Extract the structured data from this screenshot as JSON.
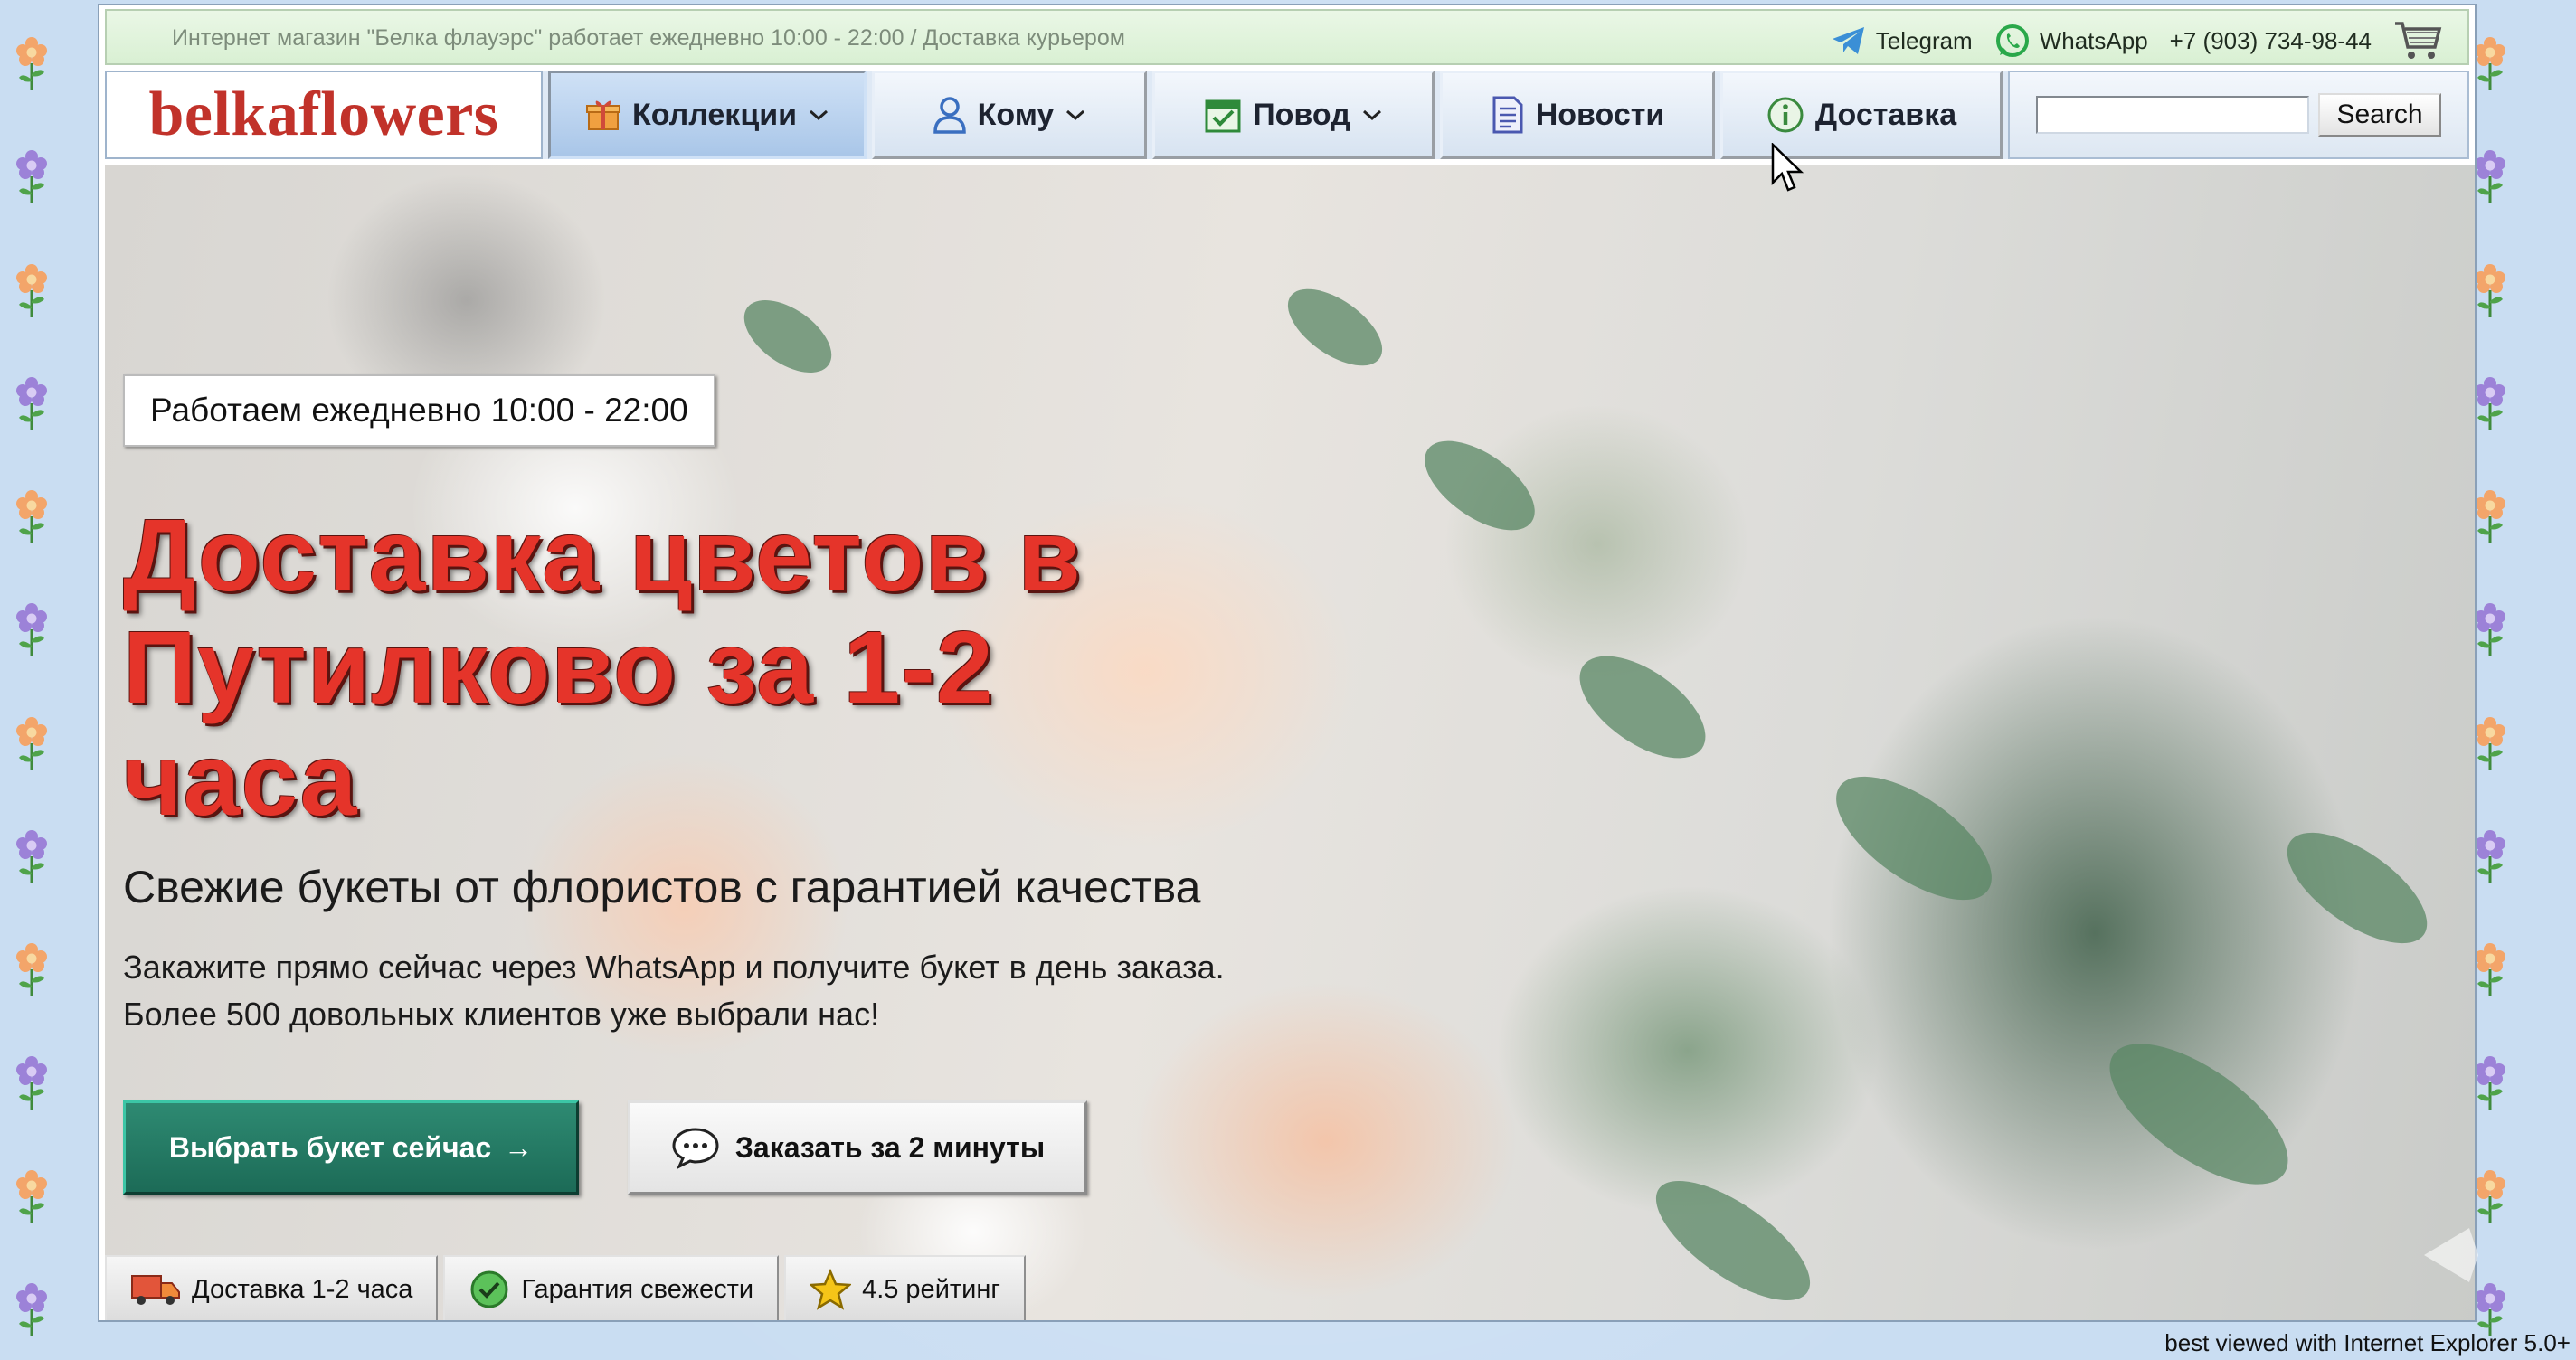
{
  "topbar": {
    "info": "Интернет магазин \"Белка флауэрс\" работает ежедневно 10:00 - 22:00 / Доставка курьером",
    "telegram": "Telegram",
    "whatsapp": "WhatsApp",
    "phone": "+7 (903) 734-98-44"
  },
  "nav": {
    "logo": "belkaflowers",
    "items": [
      {
        "label": "Коллекции",
        "icon": "gift-box-icon"
      },
      {
        "label": "Кому",
        "icon": "person-icon"
      },
      {
        "label": "Повод",
        "icon": "calendar-check-icon"
      },
      {
        "label": "Новости",
        "icon": "document-icon"
      },
      {
        "label": "Доставка",
        "icon": "info-icon"
      }
    ],
    "search_placeholder": "",
    "search_button": "Search"
  },
  "hero": {
    "hours": "Работаем ежедневно 10:00 - 22:00",
    "headline": "Доставка цветов в Путилково за 1-2 часа",
    "subhead": "Свежие букеты от флористов с гарантией качества",
    "desc_line1": "Закажите прямо сейчас через WhatsApp и получите букет в день заказа.",
    "desc_line2": "Более 500 довольных клиентов уже выбрали нас!",
    "cta_primary": "Выбрать букет сейчас",
    "cta_primary_arrow": "→",
    "cta_secondary": "Заказать за 2 минуты"
  },
  "features": [
    {
      "label": "Доставка 1-2 часа",
      "icon": "truck-icon"
    },
    {
      "label": "Гарантия свежести",
      "icon": "check-circle-icon"
    },
    {
      "label": "4.5 рейтинг",
      "icon": "star-icon"
    }
  ],
  "footer": {
    "note": "best viewed with Internet Explorer 5.0+"
  },
  "colors": {
    "logo": "#c1322a",
    "headline": "#e5342a",
    "cta_primary": "#1c6b57",
    "background": "#c9ddf2"
  }
}
